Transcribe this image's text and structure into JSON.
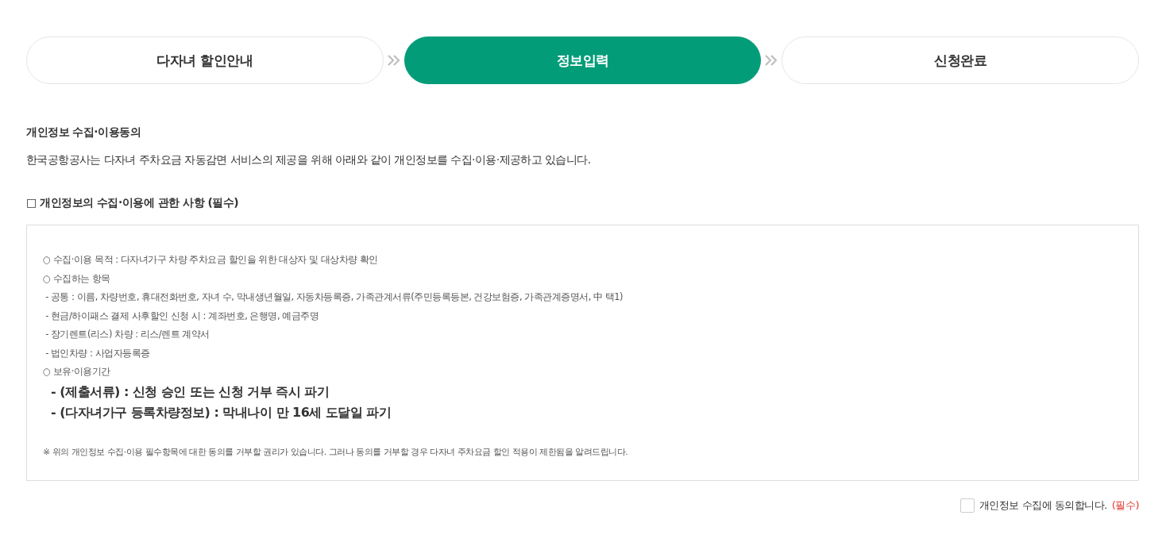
{
  "steps": [
    {
      "label": "다자녀 할인안내",
      "selected": false
    },
    {
      "label": "정보입력",
      "selected": true
    },
    {
      "label": "신청완료",
      "selected": false
    }
  ],
  "consent": {
    "title": "개인정보 수집·이용동의",
    "intro": "한국공항공사는 다자녀 주차요금 자동감면 서비스의 제공을 위해 아래와 같이 개인정보를 수집·이용·제공하고 있습니다.",
    "section_title": "□ 개인정보의 수집·이용에 관한 사항 (필수)",
    "terms": [
      {
        "kind": "item",
        "text": "○ 수집·이용 목적 : 다자녀가구 차량 주차요금 할인을 위한 대상자 및 대상차량 확인"
      },
      {
        "kind": "item",
        "text": "○ 수집하는 항목"
      },
      {
        "kind": "item",
        "text": " - 공통 : 이름, 차량번호, 휴대전화번호, 자녀 수, 막내생년월일, 자동차등록증, 가족관계서류(주민등록등본, 건강보험증, 가족관계증명서, 中 택1)"
      },
      {
        "kind": "item",
        "text": " - 현금/하이패스 결제 사후할인 신청 시 : 계좌번호, 은행명, 예금주명"
      },
      {
        "kind": "item",
        "text": " - 장기렌트(리스) 차량 : 리스/렌트 계약서"
      },
      {
        "kind": "item",
        "text": " - 법인차량 : 사업자등록증"
      },
      {
        "kind": "item",
        "text": "○ 보유·이용기간"
      },
      {
        "kind": "emphasis",
        "text": "- (제출서류) : 신청 승인 또는 신청 거부 즉시 파기"
      },
      {
        "kind": "emphasis",
        "text": "- (다자녀가구 등록차량정보) : 막내나이 만 16세 도달일 파기"
      },
      {
        "kind": "note",
        "text": "※ 위의 개인정보 수집·이용 필수항목에 대한 동의를 거부할 권리가 있습니다. 그러나 동의를 거부할 경우 다자녀 주차요금 할인 적용이 제한됨을 알려드립니다."
      }
    ],
    "agree": {
      "label": "개인정보 수집에 동의합니다.",
      "required": "(필수)",
      "checked": false
    }
  }
}
